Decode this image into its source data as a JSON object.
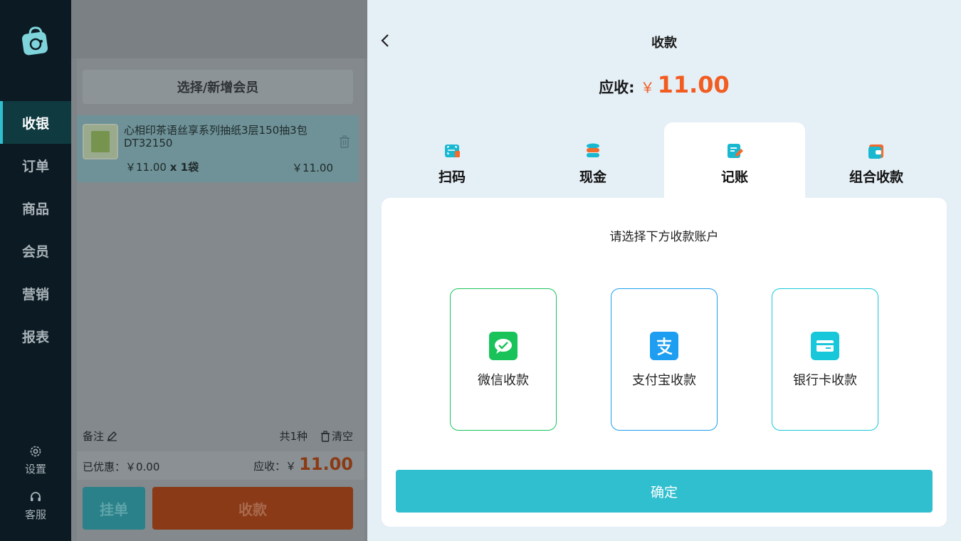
{
  "sidebar": {
    "logo_icon": "shopping-bag-icon",
    "items": [
      {
        "label": "收银",
        "active": true
      },
      {
        "label": "订单"
      },
      {
        "label": "商品"
      },
      {
        "label": "会员"
      },
      {
        "label": "营销"
      },
      {
        "label": "报表"
      }
    ],
    "settings_label": "设置",
    "support_label": "客服"
  },
  "cart": {
    "member_button": "选择/新增会员",
    "items": [
      {
        "name": "心相印茶语丝享系列抽纸3层150抽3包DT32150",
        "price": "￥11.00",
        "qty": "x 1袋",
        "total": "￥11.00"
      }
    ],
    "note_label": "备注",
    "count_label": "共1种",
    "clear_label": "清空",
    "discount_label": "已优惠：￥0.00",
    "due_label": "应收：￥",
    "due_amount": "11.00",
    "hold_button": "挂单",
    "pay_button": "收款"
  },
  "modal": {
    "title": "收款",
    "due_label": "应收:",
    "currency": "￥",
    "due_amount": "11.00",
    "tabs": [
      {
        "label": "扫码",
        "icon": "scan-icon"
      },
      {
        "label": "现金",
        "icon": "coins-icon"
      },
      {
        "label": "记账",
        "icon": "ledger-icon",
        "active": true
      },
      {
        "label": "组合收款",
        "icon": "wallet-icon"
      }
    ],
    "hint": "请选择下方收款账户",
    "accounts": [
      {
        "label": "微信收款",
        "icon": "wechat-pay-icon",
        "color": "#19c35a"
      },
      {
        "label": "支付宝收款",
        "icon": "alipay-icon",
        "color": "#1e9ef0"
      },
      {
        "label": "银行卡收款",
        "icon": "bank-card-icon",
        "color": "#18c7d9"
      }
    ],
    "confirm_button": "确定"
  },
  "colors": {
    "accent": "#30bfcf",
    "price": "#f25c20",
    "sidebar_bg": "#0c1b23"
  }
}
